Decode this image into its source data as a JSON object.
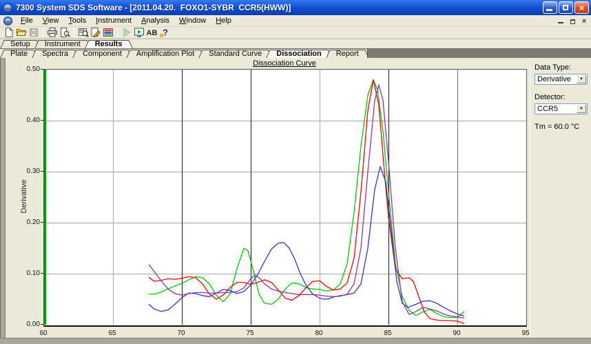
{
  "window": {
    "title": "7300 System SDS Software - [2011.04.20.  FOXO1-SYBR  CCR5(HWW)]",
    "controls": {
      "minimize": "minimize",
      "restore": "restore",
      "close": "×"
    }
  },
  "menu": {
    "items": [
      "File",
      "View",
      "Tools",
      "Instrument",
      "Analysis",
      "Window",
      "Help"
    ]
  },
  "toolbar": {
    "icons": [
      {
        "name": "new-document"
      },
      {
        "name": "open-file"
      },
      {
        "name": "save",
        "disabled": true
      },
      {
        "sep": true
      },
      {
        "name": "print"
      },
      {
        "name": "print-preview"
      },
      {
        "sep": true
      },
      {
        "name": "well-inspector"
      },
      {
        "name": "edit-plate"
      },
      {
        "name": "plate-layout"
      },
      {
        "sep": true
      },
      {
        "name": "run",
        "disabled": true
      },
      {
        "name": "run-monitor"
      },
      {
        "name": "report-ab"
      },
      {
        "name": "help"
      }
    ]
  },
  "tabs_primary": [
    {
      "label": "Setup",
      "active": false
    },
    {
      "label": "Instrument",
      "active": false
    },
    {
      "label": "Results",
      "active": true
    }
  ],
  "tabs_secondary": [
    {
      "label": "Plate",
      "active": false
    },
    {
      "label": "Spectra",
      "active": false
    },
    {
      "label": "Component",
      "active": false
    },
    {
      "label": "Amplification Plot",
      "active": false
    },
    {
      "label": "Standard Curve",
      "active": false
    },
    {
      "label": "Dissociation",
      "active": true
    },
    {
      "label": "Report",
      "active": false
    }
  ],
  "side_panel": {
    "data_type_label": "Data Type:",
    "data_type_value": "Derivative",
    "detector_label": "Detector:",
    "detector_value": "CCR5",
    "tm_value": "Tm = 60.0 °C",
    "dropdown_arrow": "▼"
  },
  "chart_data": {
    "type": "line",
    "title": "Dissociation Curve",
    "xlabel": "",
    "ylabel": "Derivative",
    "xlim": [
      60,
      95
    ],
    "ylim": [
      0,
      0.5
    ],
    "xticks": [
      60,
      65,
      70,
      75,
      80,
      85,
      90,
      95
    ],
    "yticks": [
      0,
      0.1,
      0.2,
      0.3,
      0.4,
      0.5
    ],
    "grid": true,
    "legend": "none",
    "x_axis_color": "#009900",
    "x_grid_shades": {
      "65": "#a8a8a8",
      "70": "#1a1a1a",
      "75": "#1a1a1a",
      "80": "#a8a8a8",
      "85": "#1a1a1a",
      "90": "#707070"
    },
    "y_grid_color": "#a6a6a6",
    "series": [
      {
        "name": "green-curve",
        "color": "#00cc00",
        "points": [
          [
            67.6,
            0.06
          ],
          [
            68,
            0.06
          ],
          [
            68.5,
            0.064
          ],
          [
            69,
            0.07
          ],
          [
            69.5,
            0.076
          ],
          [
            70,
            0.081
          ],
          [
            70.5,
            0.088
          ],
          [
            71,
            0.094
          ],
          [
            71.5,
            0.092
          ],
          [
            72,
            0.08
          ],
          [
            72.5,
            0.058
          ],
          [
            73,
            0.045
          ],
          [
            73.5,
            0.06
          ],
          [
            74,
            0.11
          ],
          [
            74.5,
            0.15
          ],
          [
            74.8,
            0.145
          ],
          [
            75.2,
            0.105
          ],
          [
            75.6,
            0.06
          ],
          [
            76,
            0.042
          ],
          [
            76.5,
            0.04
          ],
          [
            77,
            0.05
          ],
          [
            77.5,
            0.07
          ],
          [
            78,
            0.082
          ],
          [
            78.5,
            0.08
          ],
          [
            79,
            0.073
          ],
          [
            79.5,
            0.07
          ],
          [
            80,
            0.069
          ],
          [
            80.5,
            0.066
          ],
          [
            81,
            0.068
          ],
          [
            81.5,
            0.08
          ],
          [
            82,
            0.12
          ],
          [
            82.5,
            0.22
          ],
          [
            83,
            0.35
          ],
          [
            83.5,
            0.45
          ],
          [
            83.9,
            0.48
          ],
          [
            84.2,
            0.46
          ],
          [
            84.6,
            0.38
          ],
          [
            85,
            0.26
          ],
          [
            85.5,
            0.12
          ],
          [
            86,
            0.055
          ],
          [
            86.5,
            0.028
          ],
          [
            87,
            0.018
          ],
          [
            87.5,
            0.025
          ],
          [
            88,
            0.03
          ],
          [
            88.5,
            0.022
          ],
          [
            89,
            0.016
          ],
          [
            89.5,
            0.014
          ],
          [
            90,
            0.014
          ],
          [
            90.5,
            0.026
          ]
        ]
      },
      {
        "name": "red-curve",
        "color": "#ff0000",
        "points": [
          [
            67.6,
            0.093
          ],
          [
            68,
            0.085
          ],
          [
            68.5,
            0.087
          ],
          [
            69,
            0.09
          ],
          [
            69.5,
            0.089
          ],
          [
            70,
            0.091
          ],
          [
            70.5,
            0.094
          ],
          [
            71,
            0.092
          ],
          [
            71.5,
            0.08
          ],
          [
            72,
            0.06
          ],
          [
            72.5,
            0.05
          ],
          [
            73,
            0.058
          ],
          [
            73.5,
            0.073
          ],
          [
            74,
            0.083
          ],
          [
            74.5,
            0.083
          ],
          [
            75,
            0.079
          ],
          [
            75.5,
            0.083
          ],
          [
            76,
            0.088
          ],
          [
            76.5,
            0.083
          ],
          [
            77,
            0.068
          ],
          [
            77.5,
            0.052
          ],
          [
            78,
            0.048
          ],
          [
            78.5,
            0.057
          ],
          [
            79,
            0.072
          ],
          [
            79.5,
            0.085
          ],
          [
            80,
            0.086
          ],
          [
            80.5,
            0.075
          ],
          [
            81,
            0.068
          ],
          [
            81.5,
            0.07
          ],
          [
            82,
            0.082
          ],
          [
            82.5,
            0.13
          ],
          [
            83,
            0.26
          ],
          [
            83.5,
            0.42
          ],
          [
            83.9,
            0.48
          ],
          [
            84.3,
            0.43
          ],
          [
            84.7,
            0.3
          ],
          [
            85,
            0.21
          ],
          [
            85.5,
            0.11
          ],
          [
            86,
            0.09
          ],
          [
            86.5,
            0.092
          ],
          [
            86.8,
            0.085
          ],
          [
            87.2,
            0.055
          ],
          [
            87.6,
            0.025
          ],
          [
            88,
            0.012
          ],
          [
            88.5,
            0.009
          ],
          [
            89,
            0.008
          ],
          [
            89.5,
            0.008
          ],
          [
            90,
            0.007
          ],
          [
            90.3,
            0.004
          ],
          [
            90.5,
            0.002
          ]
        ]
      },
      {
        "name": "blue-curve",
        "color": "#3333cc",
        "points": [
          [
            67.6,
            0.04
          ],
          [
            68,
            0.031
          ],
          [
            68.5,
            0.026
          ],
          [
            69,
            0.029
          ],
          [
            69.5,
            0.04
          ],
          [
            70,
            0.053
          ],
          [
            70.5,
            0.062
          ],
          [
            71,
            0.061
          ],
          [
            71.5,
            0.057
          ],
          [
            72,
            0.055
          ],
          [
            72.5,
            0.062
          ],
          [
            73,
            0.069
          ],
          [
            73.5,
            0.067
          ],
          [
            74,
            0.061
          ],
          [
            74.5,
            0.065
          ],
          [
            75,
            0.078
          ],
          [
            75.5,
            0.098
          ],
          [
            76,
            0.124
          ],
          [
            76.5,
            0.148
          ],
          [
            77,
            0.16
          ],
          [
            77.4,
            0.161
          ],
          [
            77.8,
            0.15
          ],
          [
            78.2,
            0.128
          ],
          [
            78.6,
            0.1
          ],
          [
            79,
            0.078
          ],
          [
            79.5,
            0.06
          ],
          [
            80,
            0.052
          ],
          [
            80.3,
            0.05
          ],
          [
            80.7,
            0.051
          ],
          [
            81,
            0.054
          ],
          [
            81.5,
            0.057
          ],
          [
            82,
            0.059
          ],
          [
            82.5,
            0.062
          ],
          [
            83,
            0.08
          ],
          [
            83.5,
            0.15
          ],
          [
            84,
            0.265
          ],
          [
            84.4,
            0.31
          ],
          [
            84.8,
            0.28
          ],
          [
            85.2,
            0.185
          ],
          [
            85.6,
            0.085
          ],
          [
            86,
            0.042
          ],
          [
            86.4,
            0.034
          ],
          [
            87,
            0.04
          ],
          [
            87.5,
            0.046
          ],
          [
            88,
            0.047
          ],
          [
            88.5,
            0.042
          ],
          [
            89,
            0.034
          ],
          [
            89.5,
            0.027
          ],
          [
            90,
            0.021
          ],
          [
            90.5,
            0.017
          ]
        ]
      },
      {
        "name": "purple-curve",
        "color": "#993399",
        "points": [
          [
            67.6,
            0.118
          ],
          [
            68,
            0.104
          ],
          [
            68.5,
            0.086
          ],
          [
            69,
            0.07
          ],
          [
            69.5,
            0.061
          ],
          [
            70,
            0.058
          ],
          [
            70.5,
            0.061
          ],
          [
            71,
            0.063
          ],
          [
            71.5,
            0.063
          ],
          [
            72,
            0.062
          ],
          [
            72.5,
            0.062
          ],
          [
            73,
            0.063
          ],
          [
            73.5,
            0.063
          ],
          [
            74,
            0.065
          ],
          [
            74.5,
            0.072
          ],
          [
            75,
            0.09
          ],
          [
            75.3,
            0.097
          ],
          [
            75.7,
            0.09
          ],
          [
            76,
            0.08
          ],
          [
            76.5,
            0.07
          ],
          [
            77,
            0.066
          ],
          [
            77.5,
            0.063
          ],
          [
            78,
            0.061
          ],
          [
            78.5,
            0.059
          ],
          [
            79,
            0.059
          ],
          [
            79.5,
            0.059
          ],
          [
            80,
            0.058
          ],
          [
            80.5,
            0.056
          ],
          [
            81,
            0.055
          ],
          [
            81.5,
            0.056
          ],
          [
            82,
            0.06
          ],
          [
            82.5,
            0.08
          ],
          [
            83,
            0.15
          ],
          [
            83.5,
            0.3
          ],
          [
            84,
            0.44
          ],
          [
            84.3,
            0.47
          ],
          [
            84.6,
            0.44
          ],
          [
            85,
            0.32
          ],
          [
            85.5,
            0.15
          ],
          [
            86,
            0.045
          ],
          [
            86.5,
            0.02
          ],
          [
            87,
            0.026
          ],
          [
            87.5,
            0.034
          ],
          [
            88,
            0.031
          ],
          [
            88.5,
            0.027
          ],
          [
            89,
            0.021
          ],
          [
            89.5,
            0.017
          ],
          [
            90,
            0.015
          ],
          [
            90.5,
            0.013
          ]
        ]
      }
    ]
  }
}
